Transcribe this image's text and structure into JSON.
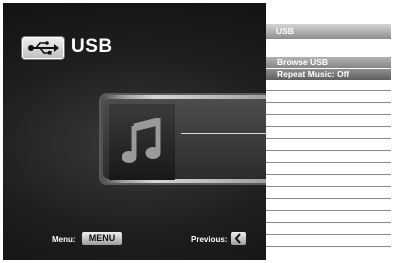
{
  "header": {
    "title": "USB",
    "logo_icon": "usb-icon"
  },
  "now_playing": {
    "thumb_icon": "music-note-icon"
  },
  "footer": {
    "menu_label": "Menu:",
    "menu_key": "MENU",
    "previous_label": "Previous:",
    "previous_icon": "chevron-left-icon"
  },
  "side_menu": {
    "title": "USB",
    "items": [
      {
        "label": "Browse USB",
        "selected": true
      },
      {
        "label": "Repeat Music: Off",
        "selected": false
      }
    ]
  },
  "colors": {
    "background": "#161616",
    "panel": "#ffffff",
    "highlight": "#9c9c9c",
    "text": "#ffffff"
  }
}
